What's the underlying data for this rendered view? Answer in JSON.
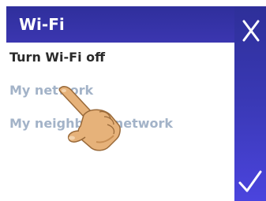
{
  "dialog": {
    "title": "Wi-Fi",
    "options": [
      {
        "label": "Turn Wi-Fi off"
      },
      {
        "label": "My network"
      },
      {
        "label": "My neighbor's network"
      }
    ],
    "close_icon": "close-icon",
    "confirm_icon": "check-icon"
  },
  "colors": {
    "header": "#30319d",
    "panel_top": "#2e2f99",
    "panel_bottom": "#4b44de",
    "primary_text": "#2a2a2a",
    "muted_text": "#a3b3c8",
    "hand_skin": "#e6b27a"
  }
}
